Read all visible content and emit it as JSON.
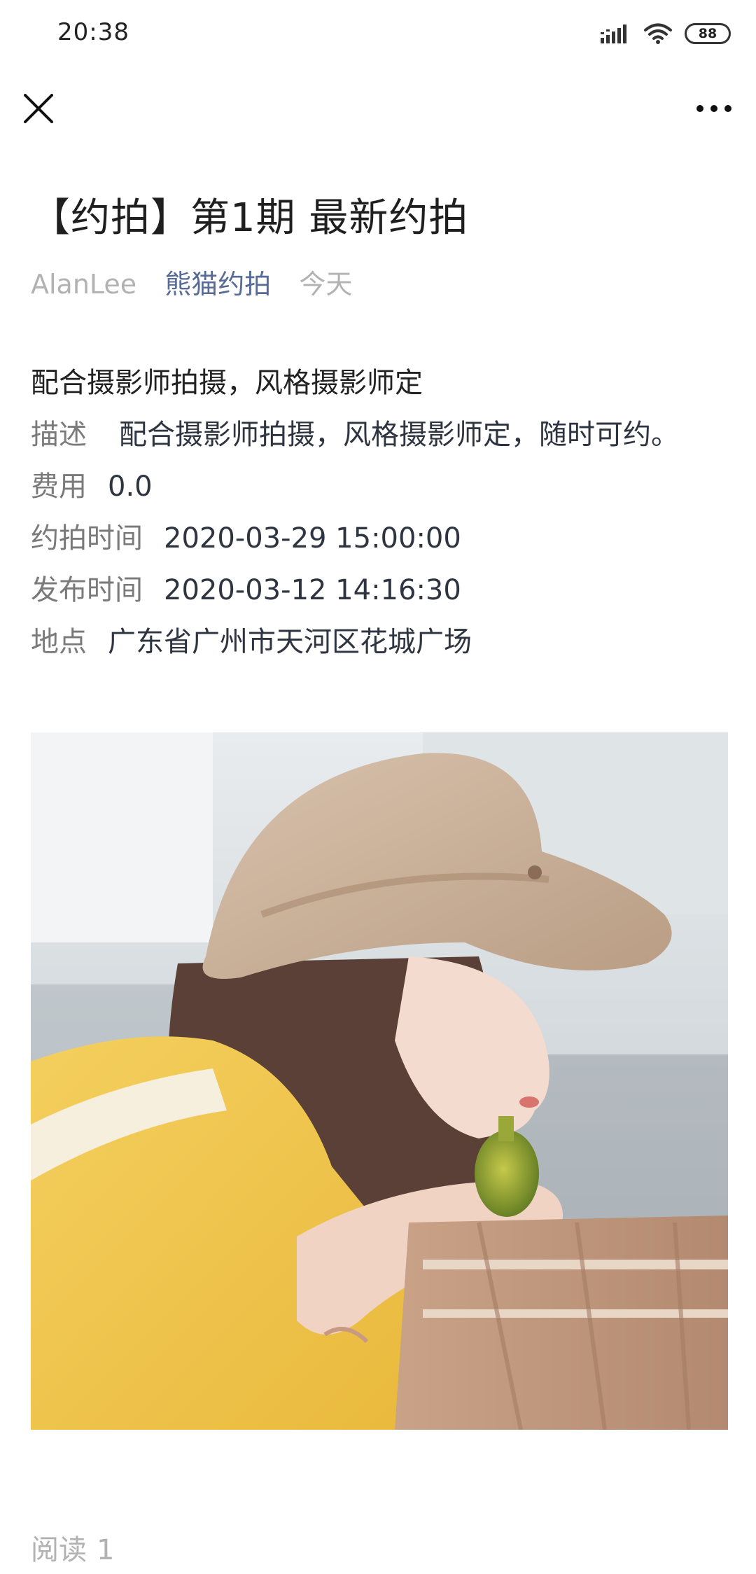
{
  "status_bar": {
    "time": "20:38",
    "battery": "88",
    "icons": [
      "signal-icon",
      "wifi-icon",
      "battery-icon"
    ]
  },
  "nav": {
    "close_icon": "close-icon",
    "more_icon": "more-icon"
  },
  "article": {
    "title": "【约拍】第1期 最新约拍",
    "author": "AlanLee",
    "account": "熊猫约拍",
    "date": "今天",
    "lead": "配合摄影师拍摄，风格摄影师定",
    "fields": {
      "description": {
        "label": "描述",
        "value": "配合摄影师拍摄，风格摄影师定，随时可约。"
      },
      "fee": {
        "label": "费用",
        "value": "0.0"
      },
      "shoot_time": {
        "label": "约拍时间",
        "value": "2020-03-29 15:00:00"
      },
      "publish_time": {
        "label": "发布时间",
        "value": "2020-03-12 14:16:30"
      },
      "location": {
        "label": "地点",
        "value": "广东省广州市天河区花城广场"
      }
    },
    "photo": "photo of a girl in a knitted sun hat and yellow top sipping from a small green bottle",
    "read_label": "阅读",
    "read_count": "1"
  },
  "colors": {
    "link": "#576b95",
    "muted": "#b2b2b2",
    "label": "#7a7a7a"
  }
}
